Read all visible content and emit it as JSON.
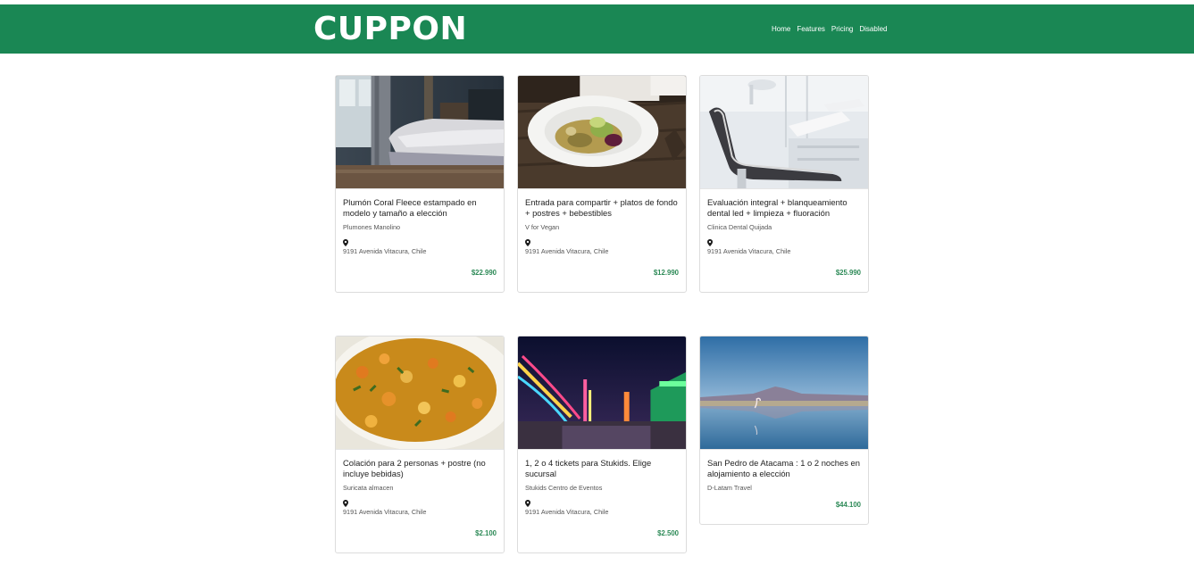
{
  "brand": "CUPPON",
  "nav": {
    "home": "Home",
    "features": "Features",
    "pricing": "Pricing",
    "disabled": "Disabled"
  },
  "colors": {
    "navbar": "#1a8754",
    "price": "#2d8a57"
  },
  "icons": {
    "location": "map-pin-icon"
  },
  "deals": [
    {
      "image": "bedroom-photo",
      "title": "Plumón Coral Fleece estampado en modelo y tamaño a elección",
      "vendor": "Plumones Manolino",
      "address": "9191 Avenida Vitacura, Chile",
      "price": "$22.990"
    },
    {
      "image": "salad-plate-photo",
      "title": "Entrada para compartir + platos de fondo + postres + bebestibles",
      "vendor": "V for Vegan",
      "address": "9191 Avenida Vitacura, Chile",
      "price": "$12.990"
    },
    {
      "image": "dental-chair-photo",
      "title": "Evaluación integral + blanqueamiento dental led + limpieza + fluoración",
      "vendor": "Clinica Dental Quijada",
      "address": "9191 Avenida Vitacura, Chile",
      "price": "$25.990"
    },
    {
      "image": "vegetable-stew-photo",
      "title": "Colación para 2 personas + postre (no incluye bebidas)",
      "vendor": "Suricata almacen",
      "address": "9191 Avenida Vitacura, Chile",
      "price": "$2.100"
    },
    {
      "image": "fairground-night-photo",
      "title": "1, 2 o 4 tickets para Stukids. Elige sucursal",
      "vendor": "Stukids Centro de Eventos",
      "address": "9191 Avenida Vitacura, Chile",
      "price": "$2.500"
    },
    {
      "image": "salt-flat-flamingo-photo",
      "title": "San Pedro de Atacama : 1 o 2 noches en alojamiento a elección",
      "vendor": "D-Latam Travel",
      "price": "$44.100"
    }
  ]
}
